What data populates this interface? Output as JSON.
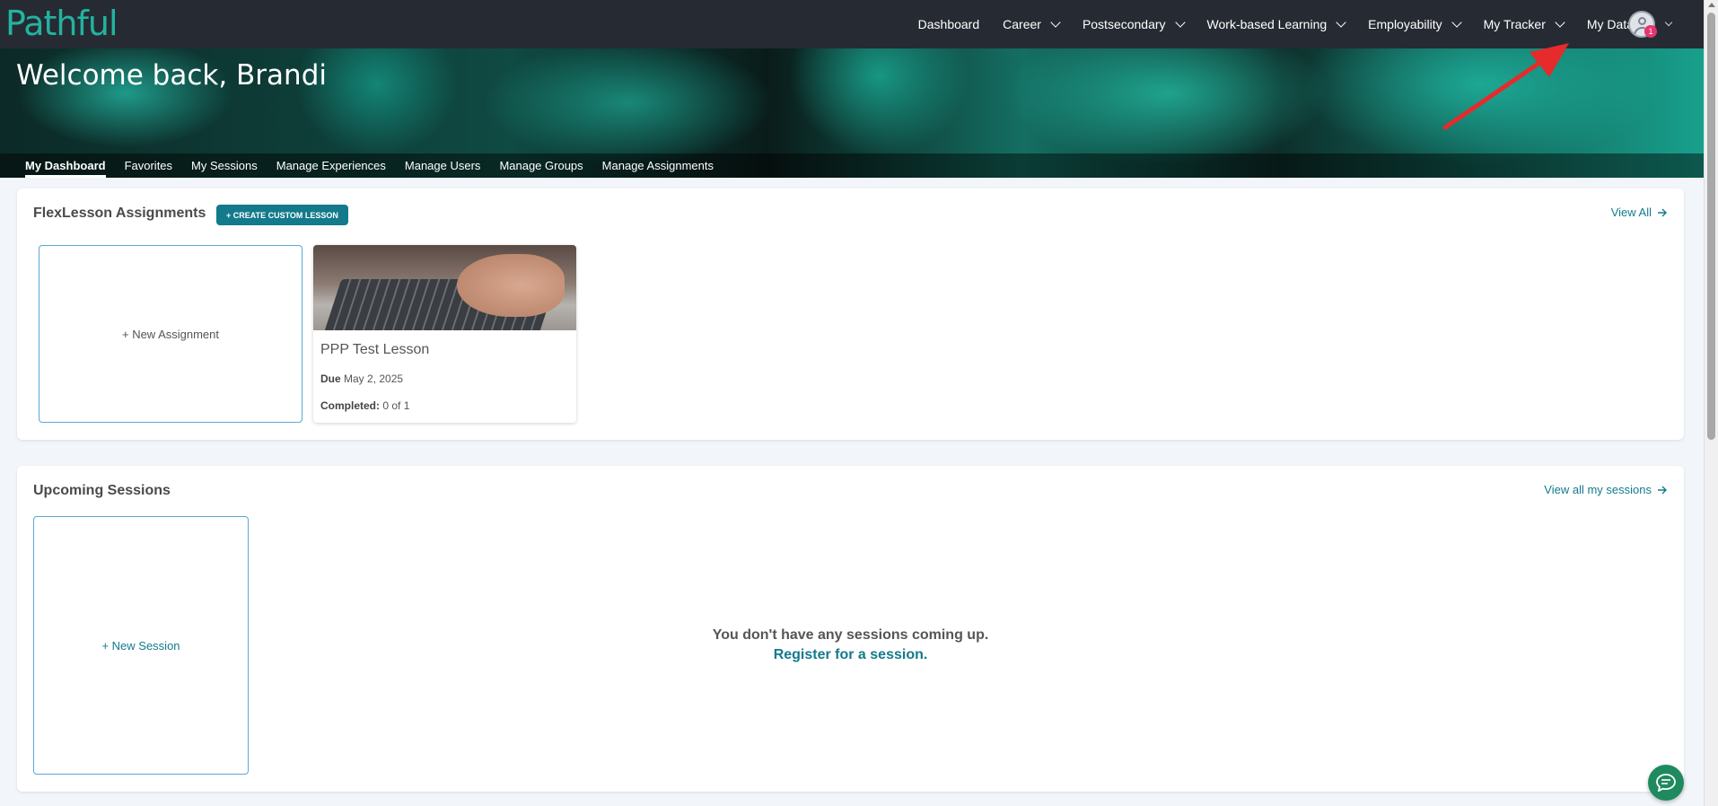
{
  "brand": {
    "logo_text": "Pathful",
    "accent": "#137a8c",
    "logo_color": "#23b3a0"
  },
  "topnav": {
    "items": [
      {
        "label": "Dashboard",
        "has_dropdown": false
      },
      {
        "label": "Career",
        "has_dropdown": true
      },
      {
        "label": "Postsecondary",
        "has_dropdown": true
      },
      {
        "label": "Work-based Learning",
        "has_dropdown": true
      },
      {
        "label": "Employability",
        "has_dropdown": true
      },
      {
        "label": "My Tracker",
        "has_dropdown": true
      },
      {
        "label": "My Data",
        "has_dropdown": true
      }
    ],
    "notification_count": "1"
  },
  "hero": {
    "title": "Welcome back, Brandi",
    "tabs": [
      {
        "label": "My Dashboard",
        "active": true
      },
      {
        "label": "Favorites"
      },
      {
        "label": "My Sessions"
      },
      {
        "label": "Manage Experiences"
      },
      {
        "label": "Manage Users"
      },
      {
        "label": "Manage Groups"
      },
      {
        "label": "Manage Assignments"
      }
    ]
  },
  "assignments": {
    "title": "FlexLesson Assignments",
    "create_button": "+ CREATE CUSTOM LESSON",
    "view_all": "View All",
    "new_card": "+ New Assignment",
    "lesson": {
      "title": "PPP Test Lesson",
      "due_label": "Due",
      "due_value": "May 2, 2025",
      "completed_label": "Completed:",
      "completed_value": "0 of 1"
    }
  },
  "sessions": {
    "title": "Upcoming Sessions",
    "view_all": "View all my sessions",
    "new_card": "+ New Session",
    "empty_message": "You don't have any sessions coming up.",
    "register_link": "Register for a session."
  },
  "icons": {
    "dropdown": "chevron-down-icon",
    "arrow_right": "arrow-right-icon",
    "chat": "chat-icon",
    "avatar": "user-avatar-icon"
  }
}
